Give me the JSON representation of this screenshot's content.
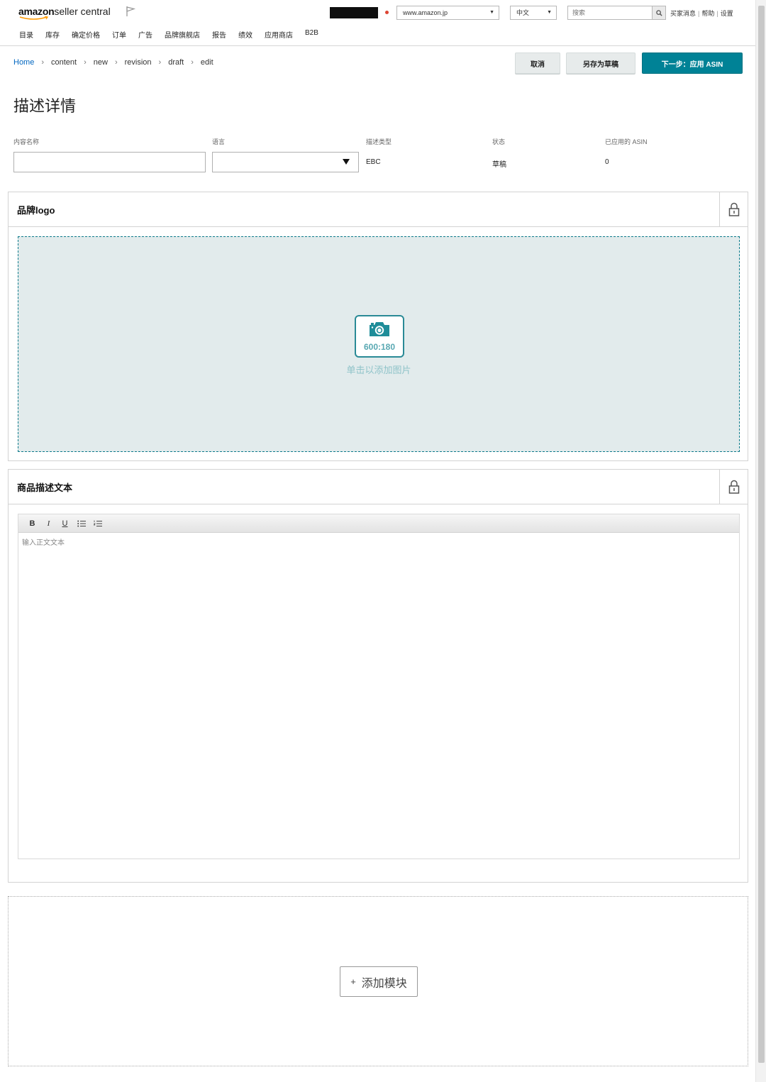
{
  "header": {
    "logo_brand": "amazon",
    "logo_product": "seller central",
    "marketplace": "www.amazon.jp",
    "language": "中文",
    "search_placeholder": "搜索",
    "links": [
      "买家消息",
      "帮助",
      "设置"
    ]
  },
  "nav": [
    "目录",
    "库存",
    "确定价格",
    "订单",
    "广告",
    "品牌旗舰店",
    "报告",
    "绩效",
    "应用商店",
    "B2B"
  ],
  "breadcrumb": [
    "Home",
    "content",
    "new",
    "revision",
    "draft",
    "edit"
  ],
  "actions": {
    "cancel": "取消",
    "save_draft": "另存为草稿",
    "next": "下一步：应用 ASIN"
  },
  "page_title": "描述详情",
  "fields": {
    "content_name_label": "内容名称",
    "content_name_value": "",
    "language_label": "语言",
    "type_label": "描述类型",
    "type_value": "EBC",
    "status_label": "状态",
    "status_value": "草稿",
    "asin_label": "已应用的 ASIN",
    "asin_value": "0"
  },
  "modules": {
    "logo": {
      "title": "品牌logo",
      "ratio": "600:180",
      "hint": "单击以添加图片"
    },
    "text": {
      "title": "商品描述文本",
      "placeholder": "输入正文文本",
      "toolbar": [
        "B",
        "I",
        "U",
        "bulleted-list",
        "numbered-list"
      ]
    }
  },
  "add_module": "添加模块",
  "colors": {
    "primary": "#008296",
    "dropzone_bg": "#e2ebec",
    "dropzone_border": "#0c7a8a",
    "link": "#0066c0"
  }
}
